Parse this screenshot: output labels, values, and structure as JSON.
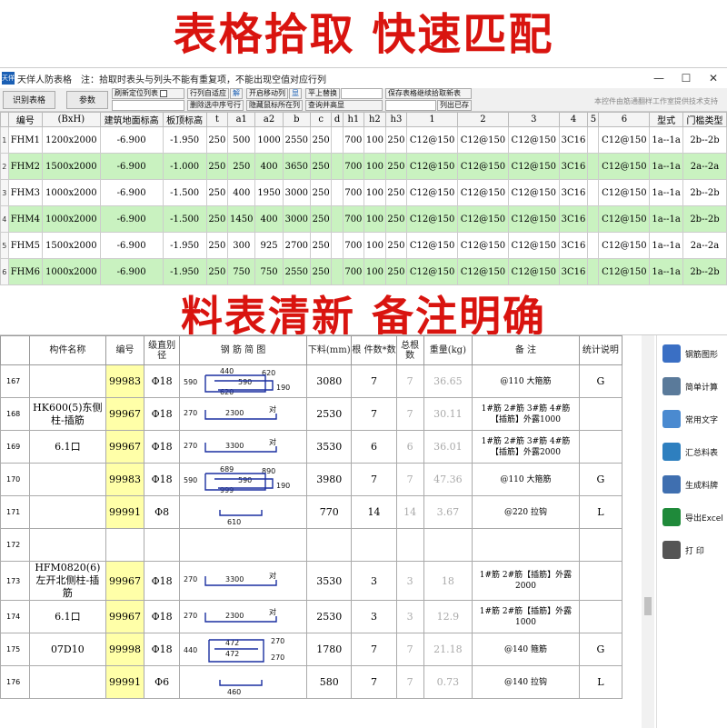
{
  "banners": {
    "top": "表格拾取 快速匹配",
    "middle": "料表清新 备注明确"
  },
  "window": {
    "app_icon": "天佯",
    "title": "天佯人防表格",
    "note": "注：拾取时表头与列头不能有重复项，不能出现空值对应行列",
    "controls": [
      "—",
      "☐",
      "✕"
    ]
  },
  "toolbar": {
    "identify": "识别表格",
    "params": "参数",
    "refresh": "刷新定位列表",
    "col_adapt": "行列自适应",
    "unlock": "解",
    "delete_rows": "删除选中序号行",
    "move_col": "开启移动列",
    "show": "显",
    "hide_cols": "隐藏鼠标所在列",
    "replace": "平上替换",
    "query": "查询并高显",
    "save_continue": "保存表格继续拾取新表",
    "col_exist": "列出已存",
    "credit": "本控件由筋通翻样工作室提供技术支持"
  },
  "top_table": {
    "headers": [
      "编号",
      "(BxH)",
      "建筑地面标高",
      "板顶标高",
      "t",
      "a1",
      "a2",
      "b",
      "c",
      "d",
      "h1",
      "h2",
      "h3",
      "1",
      "2",
      "3",
      "4",
      "5",
      "6",
      "型式",
      "门槛类型"
    ],
    "rows": [
      {
        "n": "1",
        "cells": [
          "FHM1",
          "1200x2000",
          "-6.900",
          "-1.950",
          "250",
          "500",
          "1000",
          "2550",
          "250",
          "",
          "700",
          "100",
          "250",
          "C12@150",
          "C12@150",
          "C12@150",
          "3C16",
          "",
          "C12@150",
          "1a--1a",
          "2b--2b"
        ]
      },
      {
        "n": "2",
        "cells": [
          "FHM2",
          "1500x2000",
          "-6.900",
          "-1.000",
          "250",
          "250",
          "400",
          "3650",
          "250",
          "",
          "700",
          "100",
          "250",
          "C12@150",
          "C12@150",
          "C12@150",
          "3C16",
          "",
          "C12@150",
          "1a--1a",
          "2a--2a"
        ]
      },
      {
        "n": "3",
        "cells": [
          "FHM3",
          "1000x2000",
          "-6.900",
          "-1.500",
          "250",
          "400",
          "1950",
          "3000",
          "250",
          "",
          "700",
          "100",
          "250",
          "C12@150",
          "C12@150",
          "C12@150",
          "3C16",
          "",
          "C12@150",
          "1a--1a",
          "2b--2b"
        ]
      },
      {
        "n": "4",
        "cells": [
          "FHM4",
          "1000x2000",
          "-6.900",
          "-1.500",
          "250",
          "1450",
          "400",
          "3000",
          "250",
          "",
          "700",
          "100",
          "250",
          "C12@150",
          "C12@150",
          "C12@150",
          "3C16",
          "",
          "C12@150",
          "1a--1a",
          "2b--2b"
        ]
      },
      {
        "n": "5",
        "cells": [
          "FHM5",
          "1500x2000",
          "-6.900",
          "-1.950",
          "250",
          "300",
          "925",
          "2700",
          "250",
          "",
          "700",
          "100",
          "250",
          "C12@150",
          "C12@150",
          "C12@150",
          "3C16",
          "",
          "C12@150",
          "1a--1a",
          "2a--2a"
        ]
      },
      {
        "n": "6",
        "cells": [
          "FHM6",
          "1000x2000",
          "-6.900",
          "-1.950",
          "250",
          "750",
          "750",
          "2550",
          "250",
          "",
          "700",
          "100",
          "250",
          "C12@150",
          "C12@150",
          "C12@150",
          "3C16",
          "",
          "C12@150",
          "1a--1a",
          "2b--2b"
        ]
      }
    ]
  },
  "bottom_table": {
    "headers": [
      "构件名称",
      "编号",
      "级直别径",
      "钢 筋 简 图",
      "下料(mm)",
      "根 件数*数",
      "总根数",
      "重量(kg)",
      "备 注",
      "统计说明"
    ],
    "rows": [
      {
        "n": "167",
        "name": "",
        "code": "99983",
        "grade": "Φ18",
        "shape": {
          "type": "stirrup",
          "a": "590",
          "b": "440",
          "c": "620",
          "d": "590",
          "e": "620",
          "f": "190"
        },
        "len": "3080",
        "cnt": "7",
        "total": "7",
        "wt": "36.65",
        "note": "@110 大箍筋",
        "stat": "G"
      },
      {
        "n": "168",
        "name": "HK600(5)东侧柱-插筋",
        "code": "99967",
        "grade": "Φ18",
        "shape": {
          "type": "hook",
          "a": "270",
          "b": "2300",
          "c": "对"
        },
        "len": "2530",
        "cnt": "7",
        "total": "7",
        "wt": "30.11",
        "note": "1#筋 2#筋 3#筋 4#筋【插筋】外露1000",
        "stat": ""
      },
      {
        "n": "169",
        "name": "6.1口",
        "code": "99967",
        "grade": "Φ18",
        "shape": {
          "type": "hook",
          "a": "270",
          "b": "3300",
          "c": "对"
        },
        "len": "3530",
        "cnt": "6",
        "total": "6",
        "wt": "36.01",
        "note": "1#筋 2#筋 3#筋 4#筋【插筋】外露2000",
        "stat": ""
      },
      {
        "n": "170",
        "name": "",
        "code": "99983",
        "grade": "Φ18",
        "shape": {
          "type": "stirrup",
          "a": "590",
          "b": "689",
          "c": "999",
          "d": "590",
          "e": "890",
          "f": "190"
        },
        "len": "3980",
        "cnt": "7",
        "total": "7",
        "wt": "47.36",
        "note": "@110 大箍筋",
        "stat": "G"
      },
      {
        "n": "171",
        "name": "",
        "code": "99991",
        "grade": "Φ8",
        "shape": {
          "type": "tie",
          "a": "610"
        },
        "len": "770",
        "cnt": "14",
        "total": "14",
        "wt": "3.67",
        "note": "@220 拉钩",
        "stat": "L"
      },
      {
        "n": "172",
        "name": "",
        "code": "",
        "grade": "",
        "shape": {
          "type": "none"
        },
        "len": "",
        "cnt": "",
        "total": "",
        "wt": "",
        "note": "",
        "stat": ""
      },
      {
        "n": "173",
        "name": "HFM0820(6)左开北侧柱-插筋",
        "code": "99967",
        "grade": "Φ18",
        "shape": {
          "type": "hook",
          "a": "270",
          "b": "3300",
          "c": "对"
        },
        "len": "3530",
        "cnt": "3",
        "total": "3",
        "wt": "18",
        "note": "1#筋 2#筋【插筋】外露2000",
        "stat": ""
      },
      {
        "n": "174",
        "name": "6.1口",
        "code": "99967",
        "grade": "Φ18",
        "shape": {
          "type": "hook",
          "a": "270",
          "b": "2300",
          "c": "对"
        },
        "len": "2530",
        "cnt": "3",
        "total": "3",
        "wt": "12.9",
        "note": "1#筋 2#筋【插筋】外露1000",
        "stat": ""
      },
      {
        "n": "175",
        "name": "07D10",
        "code": "99998",
        "grade": "Φ18",
        "shape": {
          "type": "box",
          "a": "440",
          "b": "472",
          "c": "472",
          "d": "270",
          "e": "270"
        },
        "len": "1780",
        "cnt": "7",
        "total": "7",
        "wt": "21.18",
        "note": "@140 箍筋",
        "stat": "G"
      },
      {
        "n": "176",
        "name": "",
        "code": "99991",
        "grade": "Φ6",
        "shape": {
          "type": "tie",
          "a": "460"
        },
        "len": "580",
        "cnt": "7",
        "total": "7",
        "wt": "0.73",
        "note": "@140 拉钩",
        "stat": "L"
      }
    ]
  },
  "sidebar": {
    "items": [
      {
        "label": "钢筋图形",
        "icon": "rebar-shape-icon",
        "color": "#3a6fc4"
      },
      {
        "label": "简单计算",
        "icon": "calculator-icon",
        "color": "#5a7a9a"
      },
      {
        "label": "常用文字",
        "icon": "text-icon",
        "color": "#4a8ad0"
      },
      {
        "label": "汇总料表",
        "icon": "sigma-icon",
        "color": "#2e7fbf"
      },
      {
        "label": "生成料牌",
        "icon": "card-icon",
        "color": "#3f6fb0"
      },
      {
        "label": "导出Excel",
        "icon": "excel-icon",
        "color": "#1f8a3a"
      },
      {
        "label": "打 印",
        "icon": "printer-icon",
        "color": "#555555"
      }
    ]
  }
}
